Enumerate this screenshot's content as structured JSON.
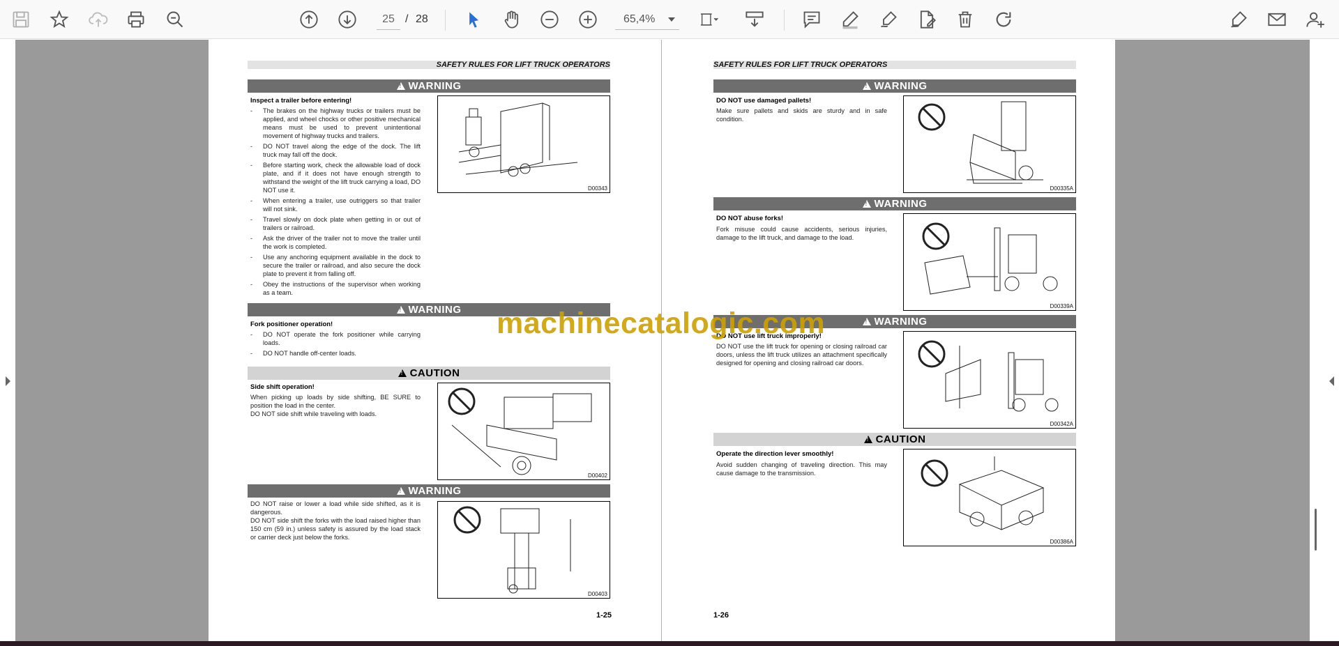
{
  "toolbar": {
    "page_current": "25",
    "page_separator": "/",
    "page_total": "28",
    "zoom": "65,4%",
    "icons": [
      "save-icon",
      "bookmark-star-icon",
      "cloud-upload-icon",
      "print-icon",
      "zoom-search-icon",
      "page-up-icon",
      "page-down-icon",
      "select-cursor-icon",
      "hand-tool-icon",
      "zoom-out-icon",
      "zoom-in-icon",
      "fit-page-icon",
      "scroll-mode-icon",
      "comment-icon",
      "highlight-pen-icon",
      "draw-signature-icon",
      "edit-export-icon",
      "delete-icon",
      "rotate-icon",
      "fill-sign-icon",
      "email-icon",
      "add-user-icon"
    ]
  },
  "watermark": "machinecatalogic.com",
  "left_page": {
    "running_head": "SAFETY RULES FOR LIFT TRUCK OPERATORS",
    "page_number": "1-25",
    "sections": [
      {
        "header": "WARNING",
        "title": "Inspect a trailer before entering!",
        "bullets": [
          "The brakes on the highway trucks or trailers must be applied, and wheel chocks or other positive mechanical means must be used to prevent unintentional movement of highway trucks and trailers.",
          "DO NOT travel along the edge of the dock. The lift truck may fall off the dock.",
          "Before starting work, check the allowable load of dock plate, and if it does not have enough strength to withstand the weight of the lift truck carrying a load, DO NOT use it.",
          "When entering a trailer, use outriggers so that trailer will not sink.",
          "Travel slowly on dock plate when getting in or out of trailers or railroad.",
          "Ask the driver of the trailer not to move the trailer until the work is completed.",
          "Use any anchoring equipment available in the dock to secure the trailer or railroad, and also secure the dock plate to prevent it from falling off.",
          "Obey the instructions of the supervisor when working as a team."
        ],
        "figure_code": "D00343"
      },
      {
        "header": "WARNING",
        "title": "Fork positioner operation!",
        "bullets": [
          "DO NOT operate the fork positioner while carrying loads.",
          "DO NOT handle off-center loads."
        ]
      },
      {
        "header": "CAUTION",
        "title": "Side shift operation!",
        "text": "When picking up loads by side shifting, BE SURE to position the load in the center.\nDO NOT side shift while traveling with loads.",
        "figure_code": "D00402"
      },
      {
        "header": "WARNING",
        "text": "DO NOT raise or lower a load while side shifted, as it is dangerous.\nDO NOT side shift the forks with the load raised higher than 150 cm (59 in.) unless safety is assured by the load stack or carrier deck just below the forks.",
        "figure_code": "D00403"
      }
    ]
  },
  "right_page": {
    "running_head": "SAFETY RULES FOR LIFT TRUCK OPERATORS",
    "page_number": "1-26",
    "sections": [
      {
        "header": "WARNING",
        "title": "DO NOT use damaged pallets!",
        "text": "Make sure pallets and skids are sturdy and in safe condition.",
        "figure_code": "D00335A"
      },
      {
        "header": "WARNING",
        "title": "DO NOT abuse forks!",
        "text": "Fork misuse could cause accidents, serious injuries, damage to the lift truck, and damage to the load.",
        "figure_code": "D00339A"
      },
      {
        "header": "WARNING",
        "title": "DO NOT use lift truck improperly!",
        "text": "DO NOT use the lift truck for opening or closing railroad car doors, unless the lift truck utilizes an attachment specifically designed for opening and closing railroad car doors.",
        "figure_code": "D00342A"
      },
      {
        "header": "CAUTION",
        "title": "Operate the direction lever smoothly!",
        "text": "Avoid sudden changing of traveling direction. This may cause damage to the transmission.",
        "figure_code": "D00386A"
      }
    ]
  }
}
